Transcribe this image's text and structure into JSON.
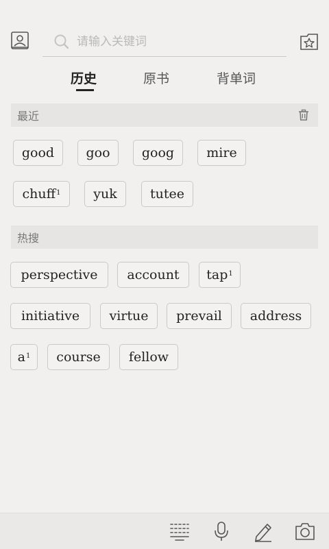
{
  "search": {
    "placeholder": "请输入关键词"
  },
  "tabs": [
    {
      "label": "历史",
      "active": true
    },
    {
      "label": "原书",
      "active": false
    },
    {
      "label": "背单词",
      "active": false
    }
  ],
  "recent": {
    "title": "最近",
    "words": [
      "good",
      "goo",
      "goog",
      "mire",
      "chuff",
      "yuk",
      "tutee"
    ],
    "superscripts": {
      "chuff": "1"
    }
  },
  "hot": {
    "title": "热搜",
    "words": [
      "perspective",
      "account",
      "tap",
      "initiative",
      "virtue",
      "prevail",
      "address",
      "a",
      "course",
      "fellow"
    ],
    "superscripts": {
      "tap": "1",
      "a": "1"
    }
  },
  "icons": {
    "top_left": "contacts-icon",
    "top_right": "star-folder-icon",
    "search": "search-icon",
    "clear_history": "trash-icon",
    "bottom": [
      "keyboard-icon",
      "microphone-icon",
      "pencil-icon",
      "camera-icon"
    ]
  }
}
